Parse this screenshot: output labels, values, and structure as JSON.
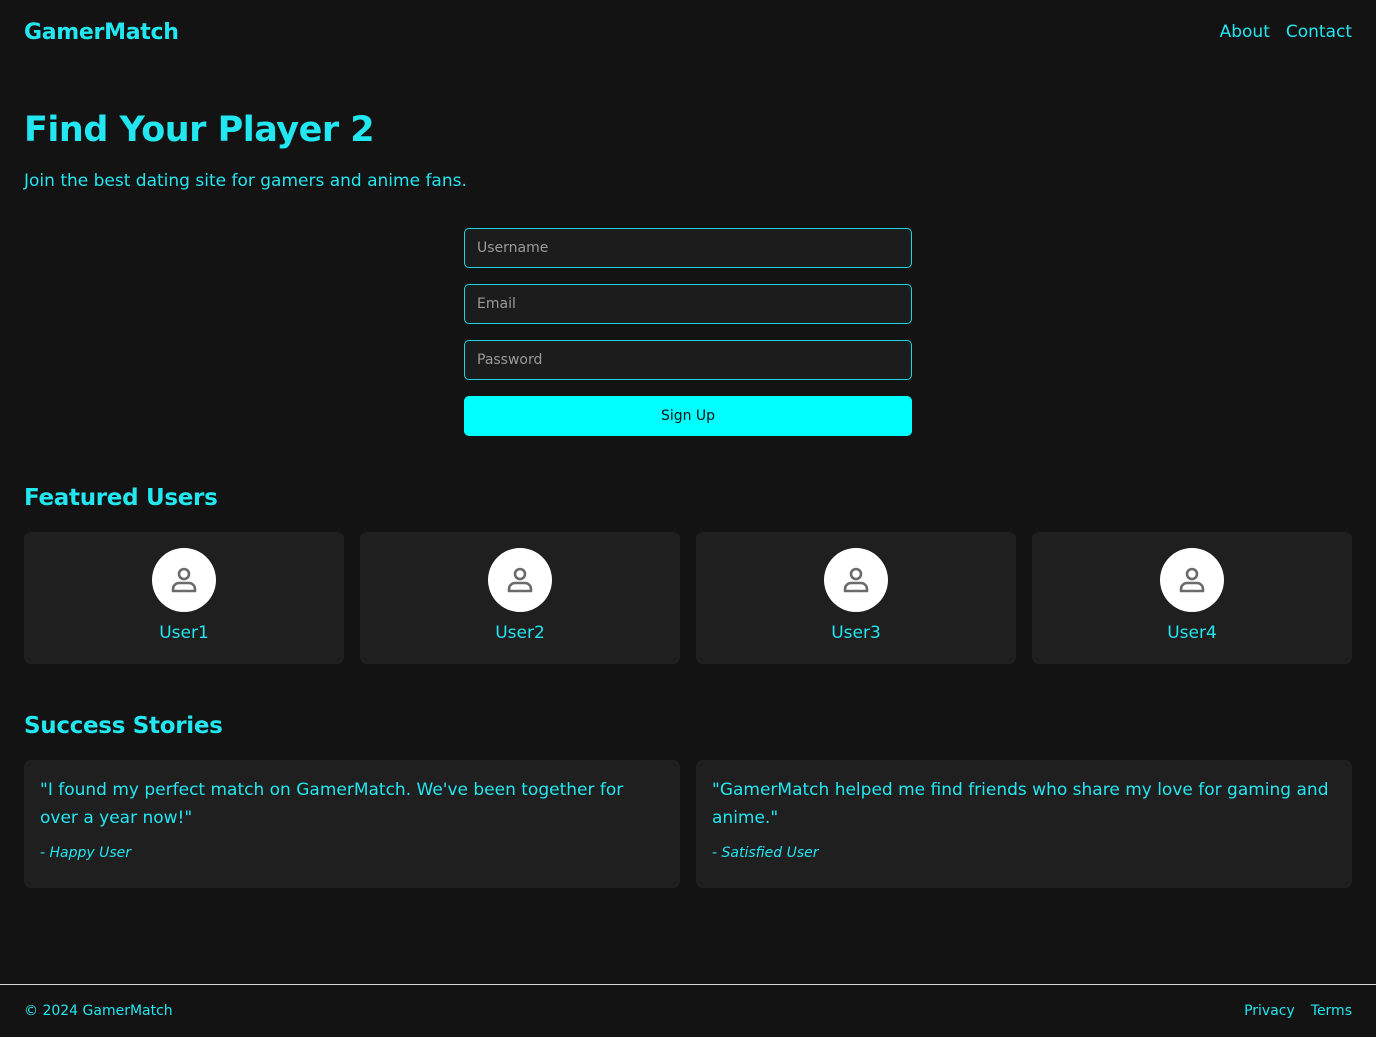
{
  "header": {
    "logo": "GamerMatch",
    "nav": [
      {
        "label": "About"
      },
      {
        "label": "Contact"
      }
    ]
  },
  "hero": {
    "title": "Find Your Player 2",
    "subtitle": "Join the best dating site for gamers and anime fans."
  },
  "signup": {
    "username_placeholder": "Username",
    "email_placeholder": "Email",
    "password_placeholder": "Password",
    "button_label": "Sign Up"
  },
  "featured": {
    "title": "Featured Users",
    "users": [
      {
        "name": "User1",
        "icon": "person-icon"
      },
      {
        "name": "User2",
        "icon": "person-icon"
      },
      {
        "name": "User3",
        "icon": "person-icon"
      },
      {
        "name": "User4",
        "icon": "person-icon"
      }
    ]
  },
  "stories": {
    "title": "Success Stories",
    "items": [
      {
        "quote": "\"I found my perfect match on GamerMatch. We've been together for over a year now!\"",
        "author": "- Happy User"
      },
      {
        "quote": "\"GamerMatch helped me find friends who share my love for gaming and anime.\"",
        "author": "- Satisfied User"
      }
    ]
  },
  "footer": {
    "copyright": "© 2024 GamerMatch",
    "links": [
      {
        "label": "Privacy"
      },
      {
        "label": "Terms"
      }
    ]
  },
  "colors": {
    "accent": "#00ffff",
    "text": "#22e6f0",
    "background": "#131313",
    "card": "#1f1f1f"
  }
}
